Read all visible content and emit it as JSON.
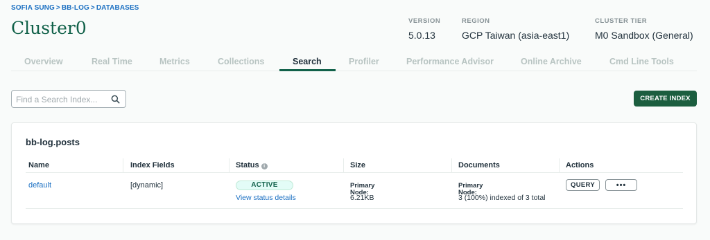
{
  "breadcrumb": [
    "SOFIA SUNG",
    "BB-LOG",
    "DATABASES"
  ],
  "breadcrumb_sep": ">",
  "cluster": {
    "name": "Cluster0",
    "version_label": "VERSION",
    "version": "5.0.13",
    "region_label": "REGION",
    "region": "GCP Taiwan (asia-east1)",
    "tier_label": "CLUSTER TIER",
    "tier": "M0 Sandbox (General)"
  },
  "tabs": [
    "Overview",
    "Real Time",
    "Metrics",
    "Collections",
    "Search",
    "Profiler",
    "Performance Advisor",
    "Online Archive",
    "Cmd Line Tools"
  ],
  "active_tab": "Search",
  "search": {
    "placeholder": "Find a Search Index..."
  },
  "create_index_label": "CREATE INDEX",
  "index_card": {
    "title": "bb-log.posts",
    "headers": [
      "Name",
      "Index Fields",
      "Status",
      "Size",
      "Documents",
      "Actions"
    ],
    "rows": [
      {
        "name": "default",
        "index_fields": "[dynamic]",
        "status": "ACTIVE",
        "status_link": "View status details",
        "size_label": "Primary Node:",
        "size": "6.21KB",
        "documents_label": "Primary Node:",
        "documents": "3 (100%) indexed of 3 total",
        "query_label": "QUERY",
        "more_label": "•••"
      }
    ]
  },
  "colors": {
    "accent_green": "#116149",
    "button_green": "#1c5e3f",
    "link_blue": "#1a6fc2",
    "badge_bg": "#e3fcf7"
  }
}
